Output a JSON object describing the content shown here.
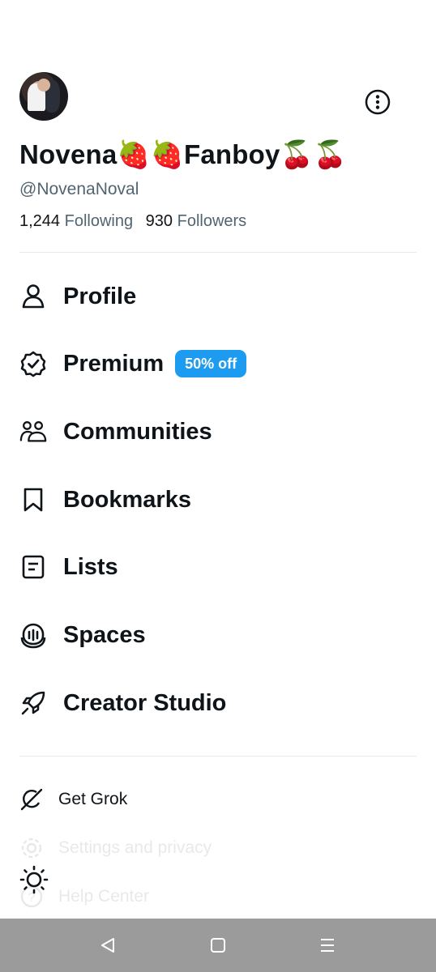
{
  "profile": {
    "display_name": "Novena🍓🍓Fanboy🍒🍒",
    "handle": "@NovenaNoval",
    "following_count": "1,244",
    "following_label": "Following",
    "followers_count": "930",
    "followers_label": "Followers",
    "avatar_icon": "user-avatar-photo",
    "more_icon": "more-options-icon"
  },
  "menu": {
    "items": [
      {
        "label": "Profile",
        "icon": "person-icon"
      },
      {
        "label": "Premium",
        "icon": "verified-badge-icon",
        "badge": "50% off"
      },
      {
        "label": "Communities",
        "icon": "communities-icon"
      },
      {
        "label": "Bookmarks",
        "icon": "bookmark-icon"
      },
      {
        "label": "Lists",
        "icon": "list-icon"
      },
      {
        "label": "Spaces",
        "icon": "spaces-icon"
      },
      {
        "label": "Creator Studio",
        "icon": "rocket-icon"
      }
    ]
  },
  "secondary": {
    "items": [
      {
        "label": "Get Grok",
        "icon": "grok-icon"
      },
      {
        "label": "Settings and privacy",
        "icon": "gear-icon"
      },
      {
        "label": "Help Center",
        "icon": "help-icon"
      }
    ],
    "theme_icon": "sun-icon"
  },
  "colors": {
    "text": "#0f1419",
    "secondary_text": "#536471",
    "accent": "#1d9bf0",
    "divider": "#e7e9ea",
    "navbar": "#9b9b9b"
  },
  "system_nav": {
    "back_icon": "back-triangle-icon",
    "home_icon": "home-square-icon",
    "recents_icon": "recents-lines-icon"
  }
}
